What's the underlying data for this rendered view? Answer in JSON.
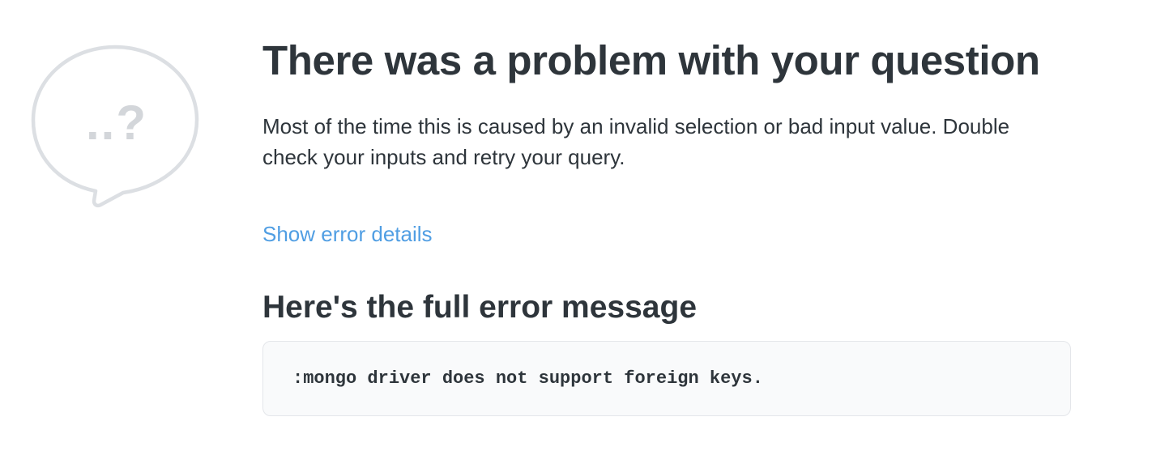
{
  "icon": {
    "name": "question-speech-bubble-icon",
    "glyph": "..?",
    "color": "#dcdfe3",
    "glyph_color": "#d3d6da"
  },
  "error": {
    "title": "There was a problem with your question",
    "description": "Most of the time this is caused by an invalid selection or bad input value. Double check your inputs and retry your query.",
    "details_link": "Show error details",
    "full_message_heading": "Here's the full error message",
    "message": ":mongo driver does not support foreign keys."
  },
  "colors": {
    "text": "#2e353b",
    "link": "#509ee3",
    "code_background": "#f9fafb",
    "code_border": "#e4e6ea"
  }
}
